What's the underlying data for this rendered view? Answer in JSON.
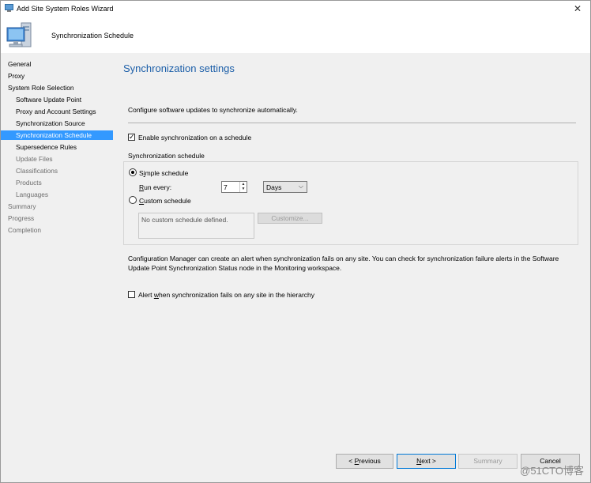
{
  "window": {
    "title": "Add Site System Roles Wizard",
    "close_glyph": "✕"
  },
  "header": {
    "title": "Synchronization Schedule"
  },
  "nav": {
    "items": [
      {
        "label": "General",
        "level": 1,
        "state": "normal"
      },
      {
        "label": "Proxy",
        "level": 1,
        "state": "normal"
      },
      {
        "label": "System Role Selection",
        "level": 1,
        "state": "normal"
      },
      {
        "label": "Software Update Point",
        "level": 2,
        "state": "normal"
      },
      {
        "label": "Proxy and Account Settings",
        "level": 2,
        "state": "normal"
      },
      {
        "label": "Synchronization Source",
        "level": 2,
        "state": "normal"
      },
      {
        "label": "Synchronization Schedule",
        "level": 2,
        "state": "selected"
      },
      {
        "label": "Supersedence Rules",
        "level": 2,
        "state": "normal"
      },
      {
        "label": "Update Files",
        "level": 2,
        "state": "disabled"
      },
      {
        "label": "Classifications",
        "level": 2,
        "state": "disabled"
      },
      {
        "label": "Products",
        "level": 2,
        "state": "disabled"
      },
      {
        "label": "Languages",
        "level": 2,
        "state": "disabled"
      },
      {
        "label": "Summary",
        "level": 1,
        "state": "disabled"
      },
      {
        "label": "Progress",
        "level": 1,
        "state": "disabled"
      },
      {
        "label": "Completion",
        "level": 1,
        "state": "disabled"
      }
    ]
  },
  "main": {
    "page_title": "Synchronization settings",
    "description": "Configure software updates to synchronize automatically.",
    "enable_schedule": {
      "label": "Enable synchronization on a schedule",
      "checked": true
    },
    "schedule_group": {
      "label": "Synchronization schedule",
      "simple": {
        "label_pre": "S",
        "label_ul": "i",
        "label_post": "mple schedule",
        "selected": true
      },
      "run_every": {
        "label_ul": "R",
        "label_post": "un every:",
        "value": "7",
        "unit": "Days"
      },
      "custom": {
        "label_ul": "C",
        "label_post": "ustom schedule",
        "selected": false
      },
      "custom_text": "No custom schedule defined.",
      "customize_label": "Customize..."
    },
    "alert_info": "Configuration Manager can create an alert when synchronization fails on any site. You can check for synchronization failure alerts in the Software Update Point Synchronization Status node in the Monitoring workspace.",
    "alert_checkbox": {
      "label_pre": "Alert ",
      "label_ul": "w",
      "label_post": "hen synchronization fails on any site in the hierarchy",
      "checked": false
    }
  },
  "buttons": {
    "previous": {
      "pre": "< ",
      "ul": "P",
      "post": "revious"
    },
    "next": {
      "ul": "N",
      "post": "ext >"
    },
    "summary": "Summary",
    "cancel": "Cancel"
  },
  "watermark": "@51CTO博客",
  "colors": {
    "accent": "#3399ff",
    "title_blue": "#1b5ea8"
  }
}
